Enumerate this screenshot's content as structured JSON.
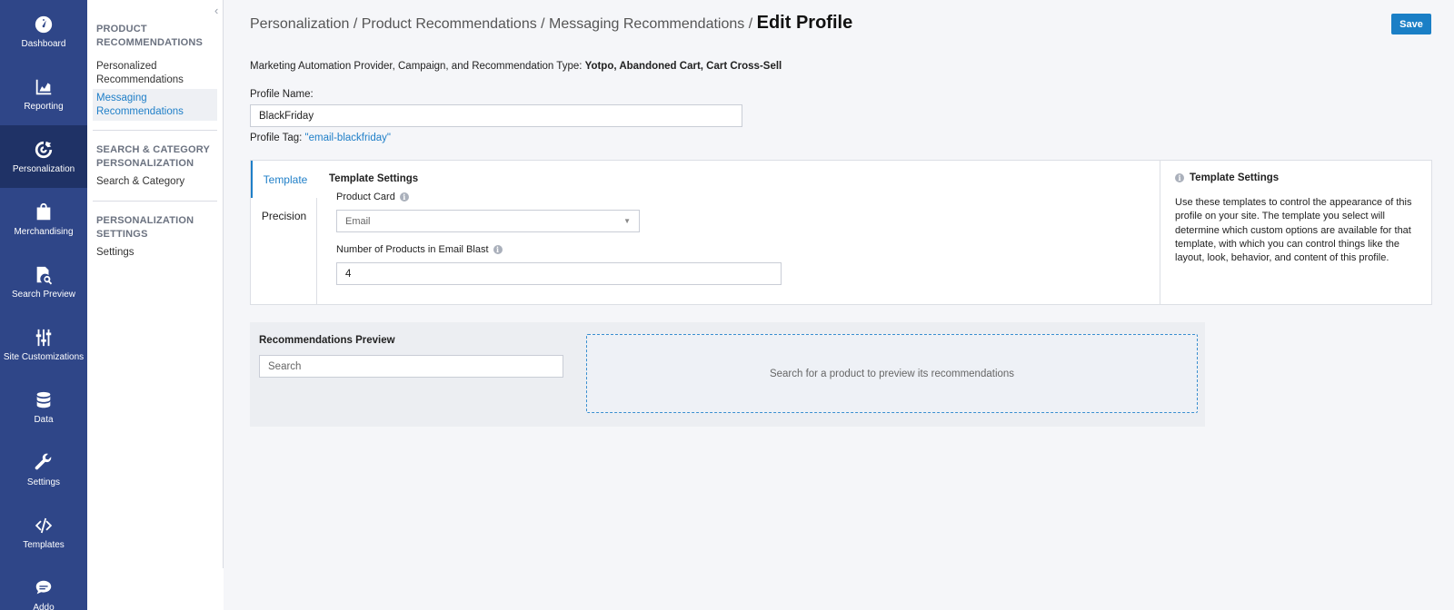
{
  "rail": {
    "items": [
      {
        "label": "Dashboard",
        "icon": "dashboard-icon"
      },
      {
        "label": "Reporting",
        "icon": "reporting-icon"
      },
      {
        "label": "Personalization",
        "icon": "personalization-icon"
      },
      {
        "label": "Merchandising",
        "icon": "merchandising-icon"
      },
      {
        "label": "Search Preview",
        "icon": "search-preview-icon"
      },
      {
        "label": "Site Customizations",
        "icon": "site-customizations-icon"
      },
      {
        "label": "Data",
        "icon": "data-icon"
      },
      {
        "label": "Settings",
        "icon": "settings-icon"
      },
      {
        "label": "Templates",
        "icon": "templates-icon"
      },
      {
        "label": "Addo",
        "icon": "chat-icon"
      }
    ],
    "active": "Personalization"
  },
  "subnav": {
    "collapse_glyph": "‹",
    "sections": [
      {
        "title": "PRODUCT RECOMMENDATIONS",
        "links": [
          "Personalized Recommendations",
          "Messaging Recommendations"
        ]
      },
      {
        "title": "SEARCH & CATEGORY PERSONALIZATION",
        "links": [
          "Search & Category"
        ]
      },
      {
        "title": "PERSONALIZATION SETTINGS",
        "links": [
          "Settings"
        ]
      }
    ]
  },
  "header": {
    "breadcrumb_trail": "Personalization / Product Recommendations / Messaging Recommendations /",
    "current": "Edit Profile",
    "save_label": "Save"
  },
  "profile": {
    "meta_prefix": "Marketing Automation Provider, Campaign, and Recommendation Type:",
    "meta_values": "Yotpo, Abandoned Cart, Cart Cross-Sell",
    "name_label": "Profile Name:",
    "name_value": "BlackFriday",
    "tag_label": "Profile Tag:",
    "tag_value": "\"email-blackfriday\""
  },
  "settings": {
    "tabs": [
      "Template",
      "Precision"
    ],
    "active_tab": "Template",
    "title": "Template Settings",
    "product_card_label": "Product Card",
    "product_card_value": "Email",
    "num_products_label": "Number of Products in Email Blast",
    "num_products_value": "4",
    "help_title": "Template Settings",
    "help_text": "Use these templates to control the appearance of this profile on your site. The template you select will determine which custom options are available for that template, with which you can control things like the layout, look, behavior, and content of this profile."
  },
  "preview": {
    "title": "Recommendations Preview",
    "search_placeholder": "Search",
    "empty_text": "Search for a product to preview its recommendations"
  },
  "colors": {
    "rail_bg": "#2f4688",
    "rail_active": "#1f3266",
    "accent": "#1a7fc6"
  }
}
